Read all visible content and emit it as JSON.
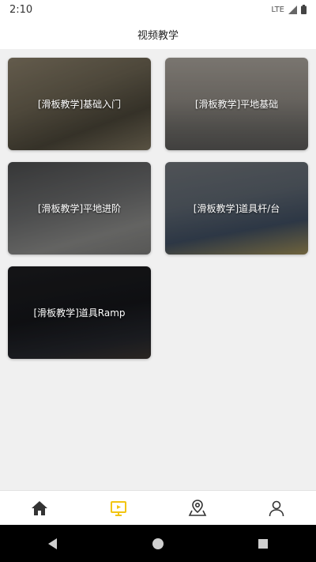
{
  "status_bar": {
    "time": "2:10",
    "network": "LTE"
  },
  "header": {
    "title": "视频教学"
  },
  "cards": [
    {
      "label": "[滑板教学]基础入门"
    },
    {
      "label": "[滑板教学]平地基础"
    },
    {
      "label": "[滑板教学]平地进阶"
    },
    {
      "label": "[滑板教学]道具杆/台"
    },
    {
      "label": "[滑板教学]道具Ramp"
    }
  ],
  "bottom_nav": [
    {
      "icon": "home-icon",
      "active": false
    },
    {
      "icon": "video-lesson-icon",
      "active": true
    },
    {
      "icon": "map-location-icon",
      "active": false
    },
    {
      "icon": "profile-icon",
      "active": false
    }
  ],
  "colors": {
    "active": "#f2c511",
    "inactive": "#333333",
    "background": "#f0f0f0"
  }
}
